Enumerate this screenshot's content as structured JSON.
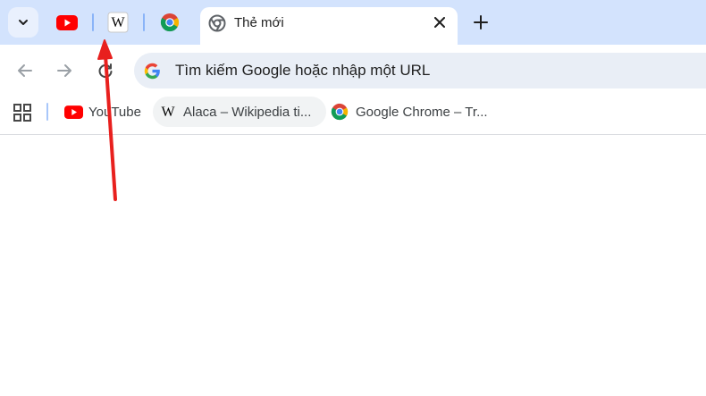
{
  "tabs": {
    "pinned": [
      {
        "name": "YouTube",
        "icon": "youtube-icon"
      },
      {
        "name": "Wikipedia",
        "icon": "wikipedia-icon"
      },
      {
        "name": "Google Chrome",
        "icon": "chrome-icon"
      }
    ],
    "active": {
      "title": "Thẻ mới",
      "icon": "chrome-outline-icon"
    }
  },
  "omnibox": {
    "placeholder": "Tìm kiếm Google hoặc nhập một URL"
  },
  "bookmarks": [
    {
      "label": "YouTube",
      "icon": "youtube-icon"
    },
    {
      "label": "Alaca – Wikipedia ti...",
      "icon": "wikipedia-icon"
    },
    {
      "label": "Google Chrome – Tr...",
      "icon": "chrome-icon"
    }
  ],
  "colors": {
    "tabstrip_bg": "#d3e3fd",
    "omnibox_bg": "#e9eef6",
    "youtube_red": "#ff0000",
    "annotation_arrow": "#e8201e"
  }
}
